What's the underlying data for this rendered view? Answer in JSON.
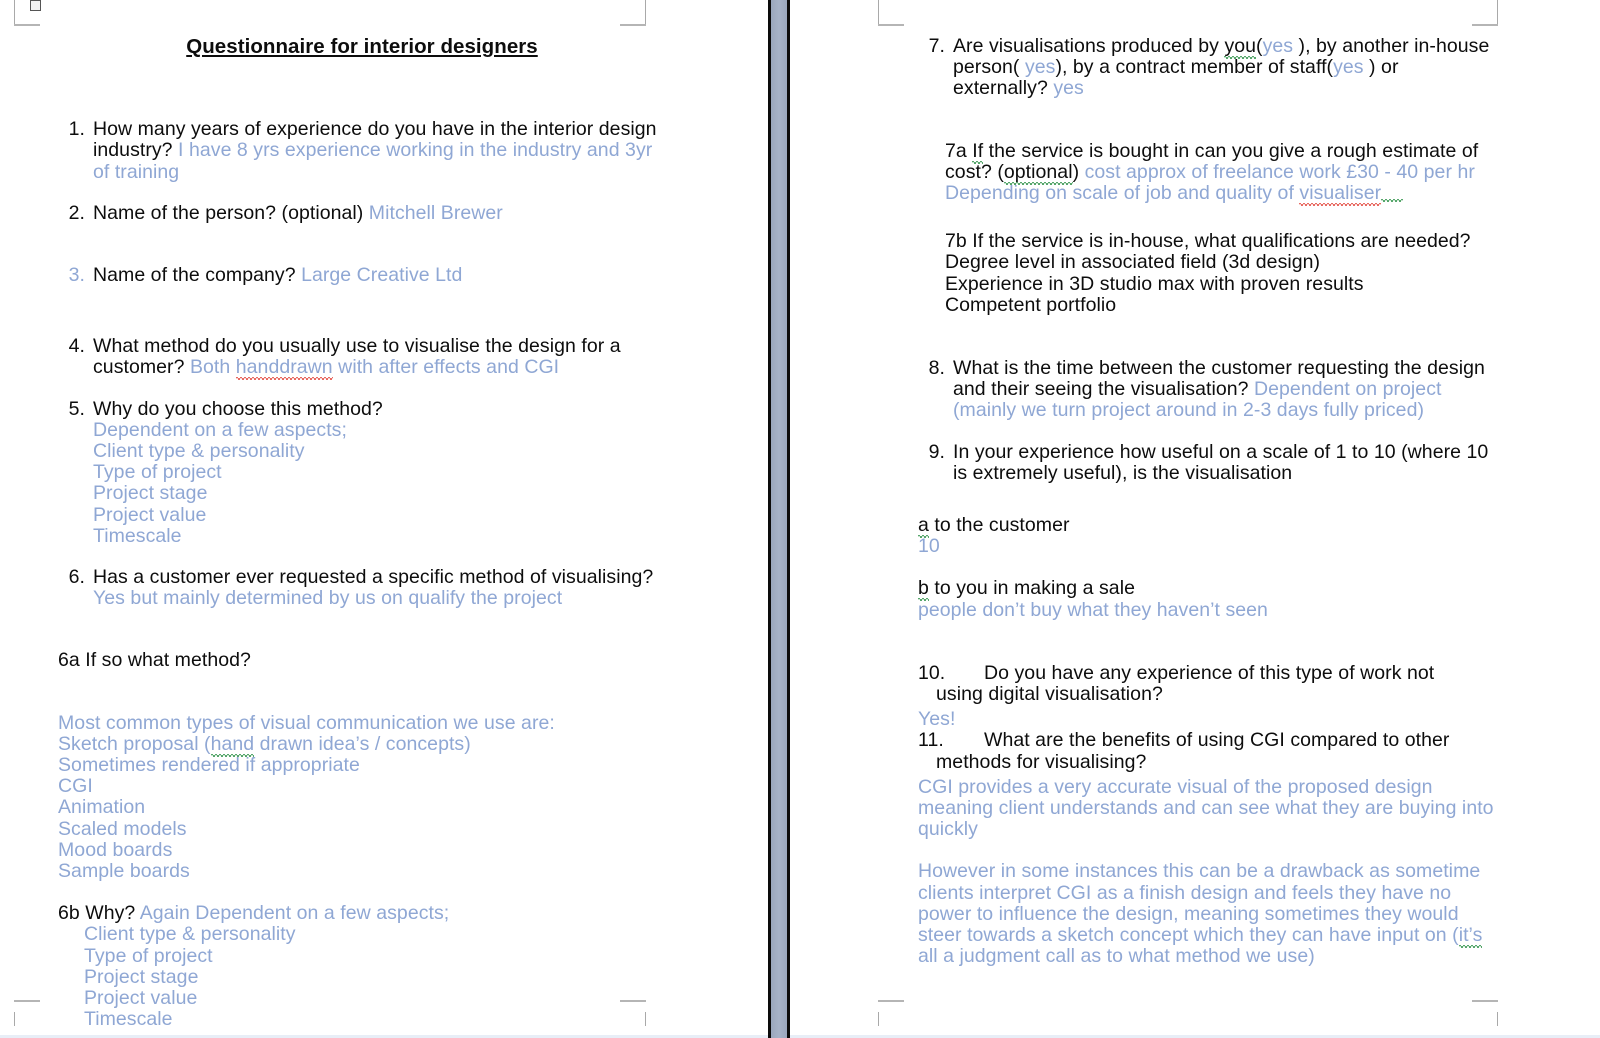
{
  "document": {
    "title": "Questionnaire for interior designers"
  },
  "colors": {
    "answer_blue": "#8fa7d4",
    "question_black": "#0d0d0d",
    "spell_red": "#e03a2f",
    "grammar_green": "#1f8a3b",
    "gutter_gray": "#a7b3c8",
    "ruler_blue": "#dce6f2"
  },
  "left_page": {
    "q1": {
      "num": "1.",
      "question": "How many years of experience do you have in the interior design industry?",
      "answer": "I have 8 yrs experience working in the industry and 3yr of training"
    },
    "q2": {
      "num": "2.",
      "question": "Name of the person? (optional)",
      "answer": "Mitchell Brewer"
    },
    "q3": {
      "num": "3.",
      "question": "Name of the company?",
      "answer": "Large Creative Ltd"
    },
    "q4": {
      "num": "4.",
      "question": "What method do you usually use to visualise the design for a customer?",
      "answer_pre": "Both ",
      "answer_misspelled": "handdrawn",
      "answer_post": " with after effects and CGI"
    },
    "q5": {
      "num": "5.",
      "question": "Why do you choose this method?",
      "answer_lines": [
        "Dependent on a few aspects;",
        "Client type & personality",
        "Type of project",
        "Project stage",
        "Project value",
        "Timescale"
      ]
    },
    "q6": {
      "num": "6.",
      "question": "Has a customer ever requested a specific method of visualising?",
      "answer": "Yes but mainly determined by us on qualify the project"
    },
    "q6a": {
      "label": "6a If so what method?",
      "answer_lines": [
        "Most common types of visual communication we use are:",
        "Sketch proposal (hand drawn idea’s / concepts)",
        "Sometimes rendered if appropriate",
        "CGI",
        "Animation",
        "Scaled models",
        "Mood boards",
        "Sample boards"
      ],
      "line2_pre": "Sketch proposal (",
      "line2_misspelled": "hand",
      "line2_post": " drawn idea’s / concepts)"
    },
    "q6b": {
      "label": "6b Why?",
      "answer_lead": "Again Dependent on a few aspects;",
      "answer_lines": [
        "Client type & personality",
        "Type of project",
        "Project stage",
        "Project value",
        "Timescale"
      ]
    }
  },
  "right_page": {
    "q7": {
      "num": "7.",
      "seg1": "Are visualisations produced by ",
      "seg1_grammar": "you",
      "seg2": "(",
      "ans1": "yes",
      "seg3": " ), by another in-house person( ",
      "ans2": "yes",
      "seg4": "), by a contract member of staff(",
      "ans3": "yes",
      "seg5": " ) or externally? ",
      "ans4": "yes"
    },
    "q7a": {
      "label_pre": "7a ",
      "label_grammar": "If",
      "label_mid": " the service is bought in can you give a rough estimate of cost? (",
      "label_grammar2": "optional",
      "label_end": ") ",
      "answer_l1": "cost approx of freelance work £30 - 40 per hr",
      "answer_l2_pre": "Depending on scale of job and quality of ",
      "answer_l2_misspelled": "visualiser"
    },
    "q7b": {
      "label": "7b If the service is in-house, what qualifications are needed?",
      "lines": [
        "Degree level in associated field (3d design)",
        "Experience in 3D studio max with proven results",
        "Competent portfolio"
      ]
    },
    "q8": {
      "num": "8.",
      "question": "What is the time between the customer requesting the design and their seeing the visualisation?",
      "answer": "Dependent on project (mainly we turn project around in 2-3 days fully priced)"
    },
    "q9": {
      "num": "9.",
      "question": "In your experience how useful on a scale of 1 to 10 (where 10 is extremely useful), is the visualisation",
      "sub_a": {
        "marker": "a",
        "label": " to the customer",
        "answer": "10"
      },
      "sub_b": {
        "marker": "b",
        "label": " to you in making a sale",
        "answer": "people don’t buy what they haven’t seen"
      }
    },
    "q10": {
      "num": "10.",
      "question_l1": "Do you have any experience of this type of work not",
      "question_l2": "using digital visualisation?",
      "answer": "Yes!"
    },
    "q11": {
      "num": "11.",
      "question_l1": "What are the benefits of using CGI compared to other",
      "question_l2": "methods for visualising?",
      "answer_p1": "CGI provides a very accurate visual of the proposed design meaning client understands and can see what they are buying into quickly",
      "answer_p2_pre": "However in some instances this can be a drawback as sometime clients interpret CGI as a finish design and feels they have no power to influence the design, meaning sometimes they would steer towards a sketch concept which they can have input on (",
      "answer_p2_grammar": "it’s",
      "answer_p2_post": " all a judgment call as to what method we use)"
    }
  }
}
